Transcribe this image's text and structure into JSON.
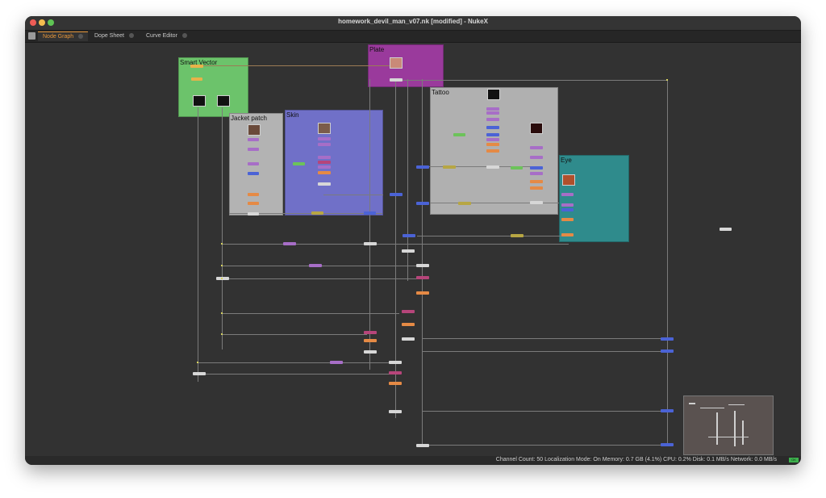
{
  "window": {
    "title": "homework_devil_man_v07.nk [modified] - NukeX"
  },
  "tabs": [
    {
      "label": "Node Graph",
      "active": true
    },
    {
      "label": "Dope Sheet",
      "active": false
    },
    {
      "label": "Curve Editor",
      "active": false
    }
  ],
  "backdrops": {
    "smart_vector": "Smart Vector",
    "plate": "Plate",
    "jacket_patch": "Jacket patch",
    "skin": "Skin",
    "tattoo": "Tattoo",
    "eye": "Eye"
  },
  "status": {
    "text": "Channel Count: 50  Localization Mode: On  Memory: 0.7 GB (4.1%)  CPU: 0.2%  Disk: 0.1 MB/s  Network: 0.0 MB/s",
    "indicator": "OK"
  },
  "colors": {
    "accent": "#e6963a",
    "smart_vector": "#6cc36b",
    "plate": "#9a3a9c",
    "jacket_patch": "#b3b3b3",
    "skin": "#7070c8",
    "tattoo": "#b0b0b0",
    "eye": "#2f8b8c"
  }
}
